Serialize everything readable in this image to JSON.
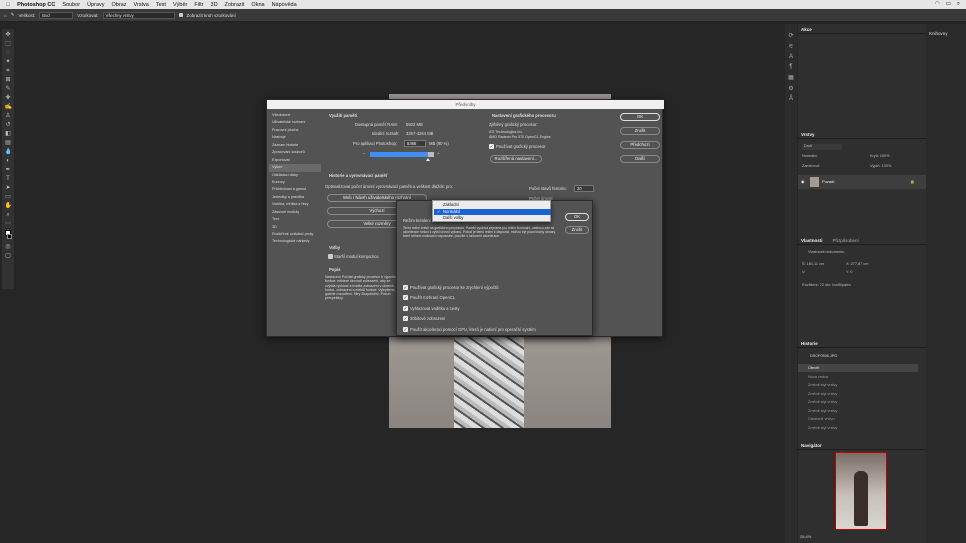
{
  "menubar": {
    "app": "Photoshop CC",
    "items": [
      "Soubor",
      "Úpravy",
      "Obraz",
      "Vrstva",
      "Text",
      "Výběr",
      "Filtr",
      "3D",
      "Zobrazit",
      "Okna",
      "Nápověda"
    ]
  },
  "options_bar": {
    "size_label": "Velikost:",
    "size_value": "Bod",
    "sample_label": "Vzorkovat:",
    "sample_value": "Všechny vrstvy",
    "ring_label": "Zobrazit kruh vzorkování"
  },
  "panels": {
    "akce": "Akce",
    "vrstvy": "Vrstvy",
    "layer_search": "Druh",
    "blend": "Normální",
    "opacity": "Krytí: 100%",
    "lock": "Zamknout:",
    "fill": "Výplň: 100%",
    "layer_name": "Pozadí",
    "vlastnosti": "Vlastnosti",
    "prizpusobeni": "Přizpůsobení",
    "doc_props": "Vlastnosti dokumentu",
    "w_label": "Š: 181,11 cm",
    "x_label": "X: 277,87 cm",
    "h_label": "V:",
    "y_label": "Y: 0",
    "resolution": "Rozlišení: 72 obr. bodů/palec",
    "historie": "Historie",
    "history_file": "DSCF0536.JPG",
    "history_items": [
      "Otevřít",
      "Nová vrstva",
      "Změnit styl vrstvy",
      "Změnit styl vrstvy",
      "Změnit styl vrstvy",
      "Změnit styl vrstvy",
      "Odstranit vrstvu",
      "Změnit styl vrstvy"
    ],
    "navigator": "Navigátor",
    "zoom": "28,4%",
    "knihovny": "Knihovny"
  },
  "prefs": {
    "title": "Předvolby",
    "categories": [
      "Všeobecné",
      "Uživatelské rozhraní",
      "Pracovní plocha",
      "Nástroje",
      "Záznam historie",
      "Zpracování souborů",
      "Exportovat",
      "Výkon",
      "Odkládací disky",
      "Kurzory",
      "Průhlednost a gamut",
      "Jednotky a pravítka",
      "Vodítka, mřížka a řezy",
      "Zásuvné moduly",
      "Text",
      "3D",
      "Rozšířené ovládací prvky",
      "Technologické náhledy"
    ],
    "active_category": 7,
    "mem_title": "Využití paměti",
    "mem_avail_label": "Dostupná paměť RAM:",
    "mem_avail_value": "5923 MB",
    "mem_ideal_label": "Ideální rozsah:",
    "mem_ideal_value": "3257-4264 MB",
    "mem_ps_label": "Pro aplikaci Photoshop:",
    "mem_ps_value": "5368",
    "mem_ps_pct": "MB (90 %)",
    "mem_slider_fraction": 0.9,
    "gpu_title": "Nastavení grafického procesoru",
    "gpu_detected": "Zjištěný grafický procesor:",
    "gpu_vendor": "ATI Technologies Inc.",
    "gpu_model": "AMD Radeon Pro 570 OpenGL Engine",
    "gpu_use": "Používat grafický procesor",
    "gpu_adv": "Rozšířená nastavení...",
    "hist_title": "Historie a vyrovnávací paměť",
    "hist_opt": "Optimalizovat počet úrovní vyrovnávací paměti a velikost dlaždic pro:",
    "hist_btn1": "Web / Návrh uživatelského rozhraní",
    "hist_btn2": "Výchozí",
    "hist_btn3": "Velké rozměry",
    "hist_states_label": "Počet stavů historie:",
    "hist_states_value": "20",
    "hist_cache_label": "Počet úrovní",
    "options_title": "Volby",
    "legacy": "Starší modul kompozice",
    "desc_title": "Popis",
    "desc": "Nastavení Počítat grafický procesor k výpočtu funkce: některé činnosti zobrazení, aby se zvýšila rychlost a kvalita zobrazení v oknech funkcí, zobrazení a efektů funkce: Vylepšené, galerie rozostření, filtry Zkapalnění, Posun perspektivy,",
    "ok": "OK",
    "cancel": "Zrušit",
    "prev": "Předchozí",
    "next": "Další"
  },
  "sub": {
    "mode_label": "Režim kreslení",
    "options": [
      "Základní",
      "Normální",
      "Další volby"
    ],
    "highlighted": 1,
    "checked": 1,
    "desc": "Tento režim kreslí na grafickém procesoru. Paměť využívá zejména pro režim Normální, zatímco zde se akcelerace funkcí s vyšší úrovní výkonu. Pokud je tento režim k dispozici, mohou být pozorovány obrazy, které během malování rozpoznáte, použité s funkcemi akcelerace.",
    "ok": "OK",
    "cancel": "Zrušit",
    "checks": [
      "Používat grafický procesor ke zrychlení výpočtů",
      "Použít rozhraní OpenCL",
      "Vyhlazovat vodítka a cesty",
      "30bitové zobrazení",
      "Použít akceleraci pomocí GPU, která je nativní pro operační systém"
    ]
  }
}
